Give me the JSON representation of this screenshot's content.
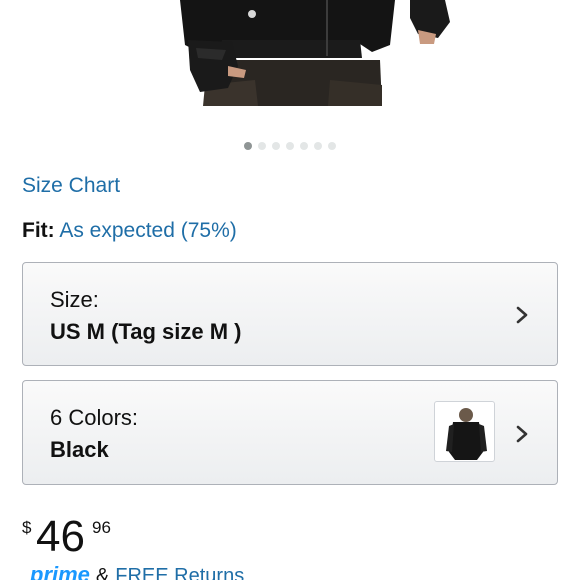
{
  "carousel": {
    "image": "black-softshell-jacket-model",
    "dot_count": 7,
    "active_index": 0
  },
  "size_chart": {
    "label": "Size Chart"
  },
  "fit": {
    "label": "Fit:",
    "value": "As expected (75%)"
  },
  "size_selector": {
    "label": "Size:",
    "value": "US M (Tag size M )",
    "icon": "chevron-right-icon"
  },
  "color_selector": {
    "label": "6 Colors:",
    "value": "Black",
    "thumbnail": "black-jacket-thumbnail",
    "icon": "chevron-right-icon"
  },
  "price": {
    "currency": "$",
    "whole": "46",
    "fraction": "96"
  },
  "shipping": {
    "prime_label": "prime",
    "connector": "&",
    "returns_label": "FREE Returns"
  },
  "colors": {
    "link": "#1f6ea7",
    "prime": "#1a98ff",
    "dot_active": "#8f9595",
    "dot_inactive": "#e3e6e6"
  }
}
